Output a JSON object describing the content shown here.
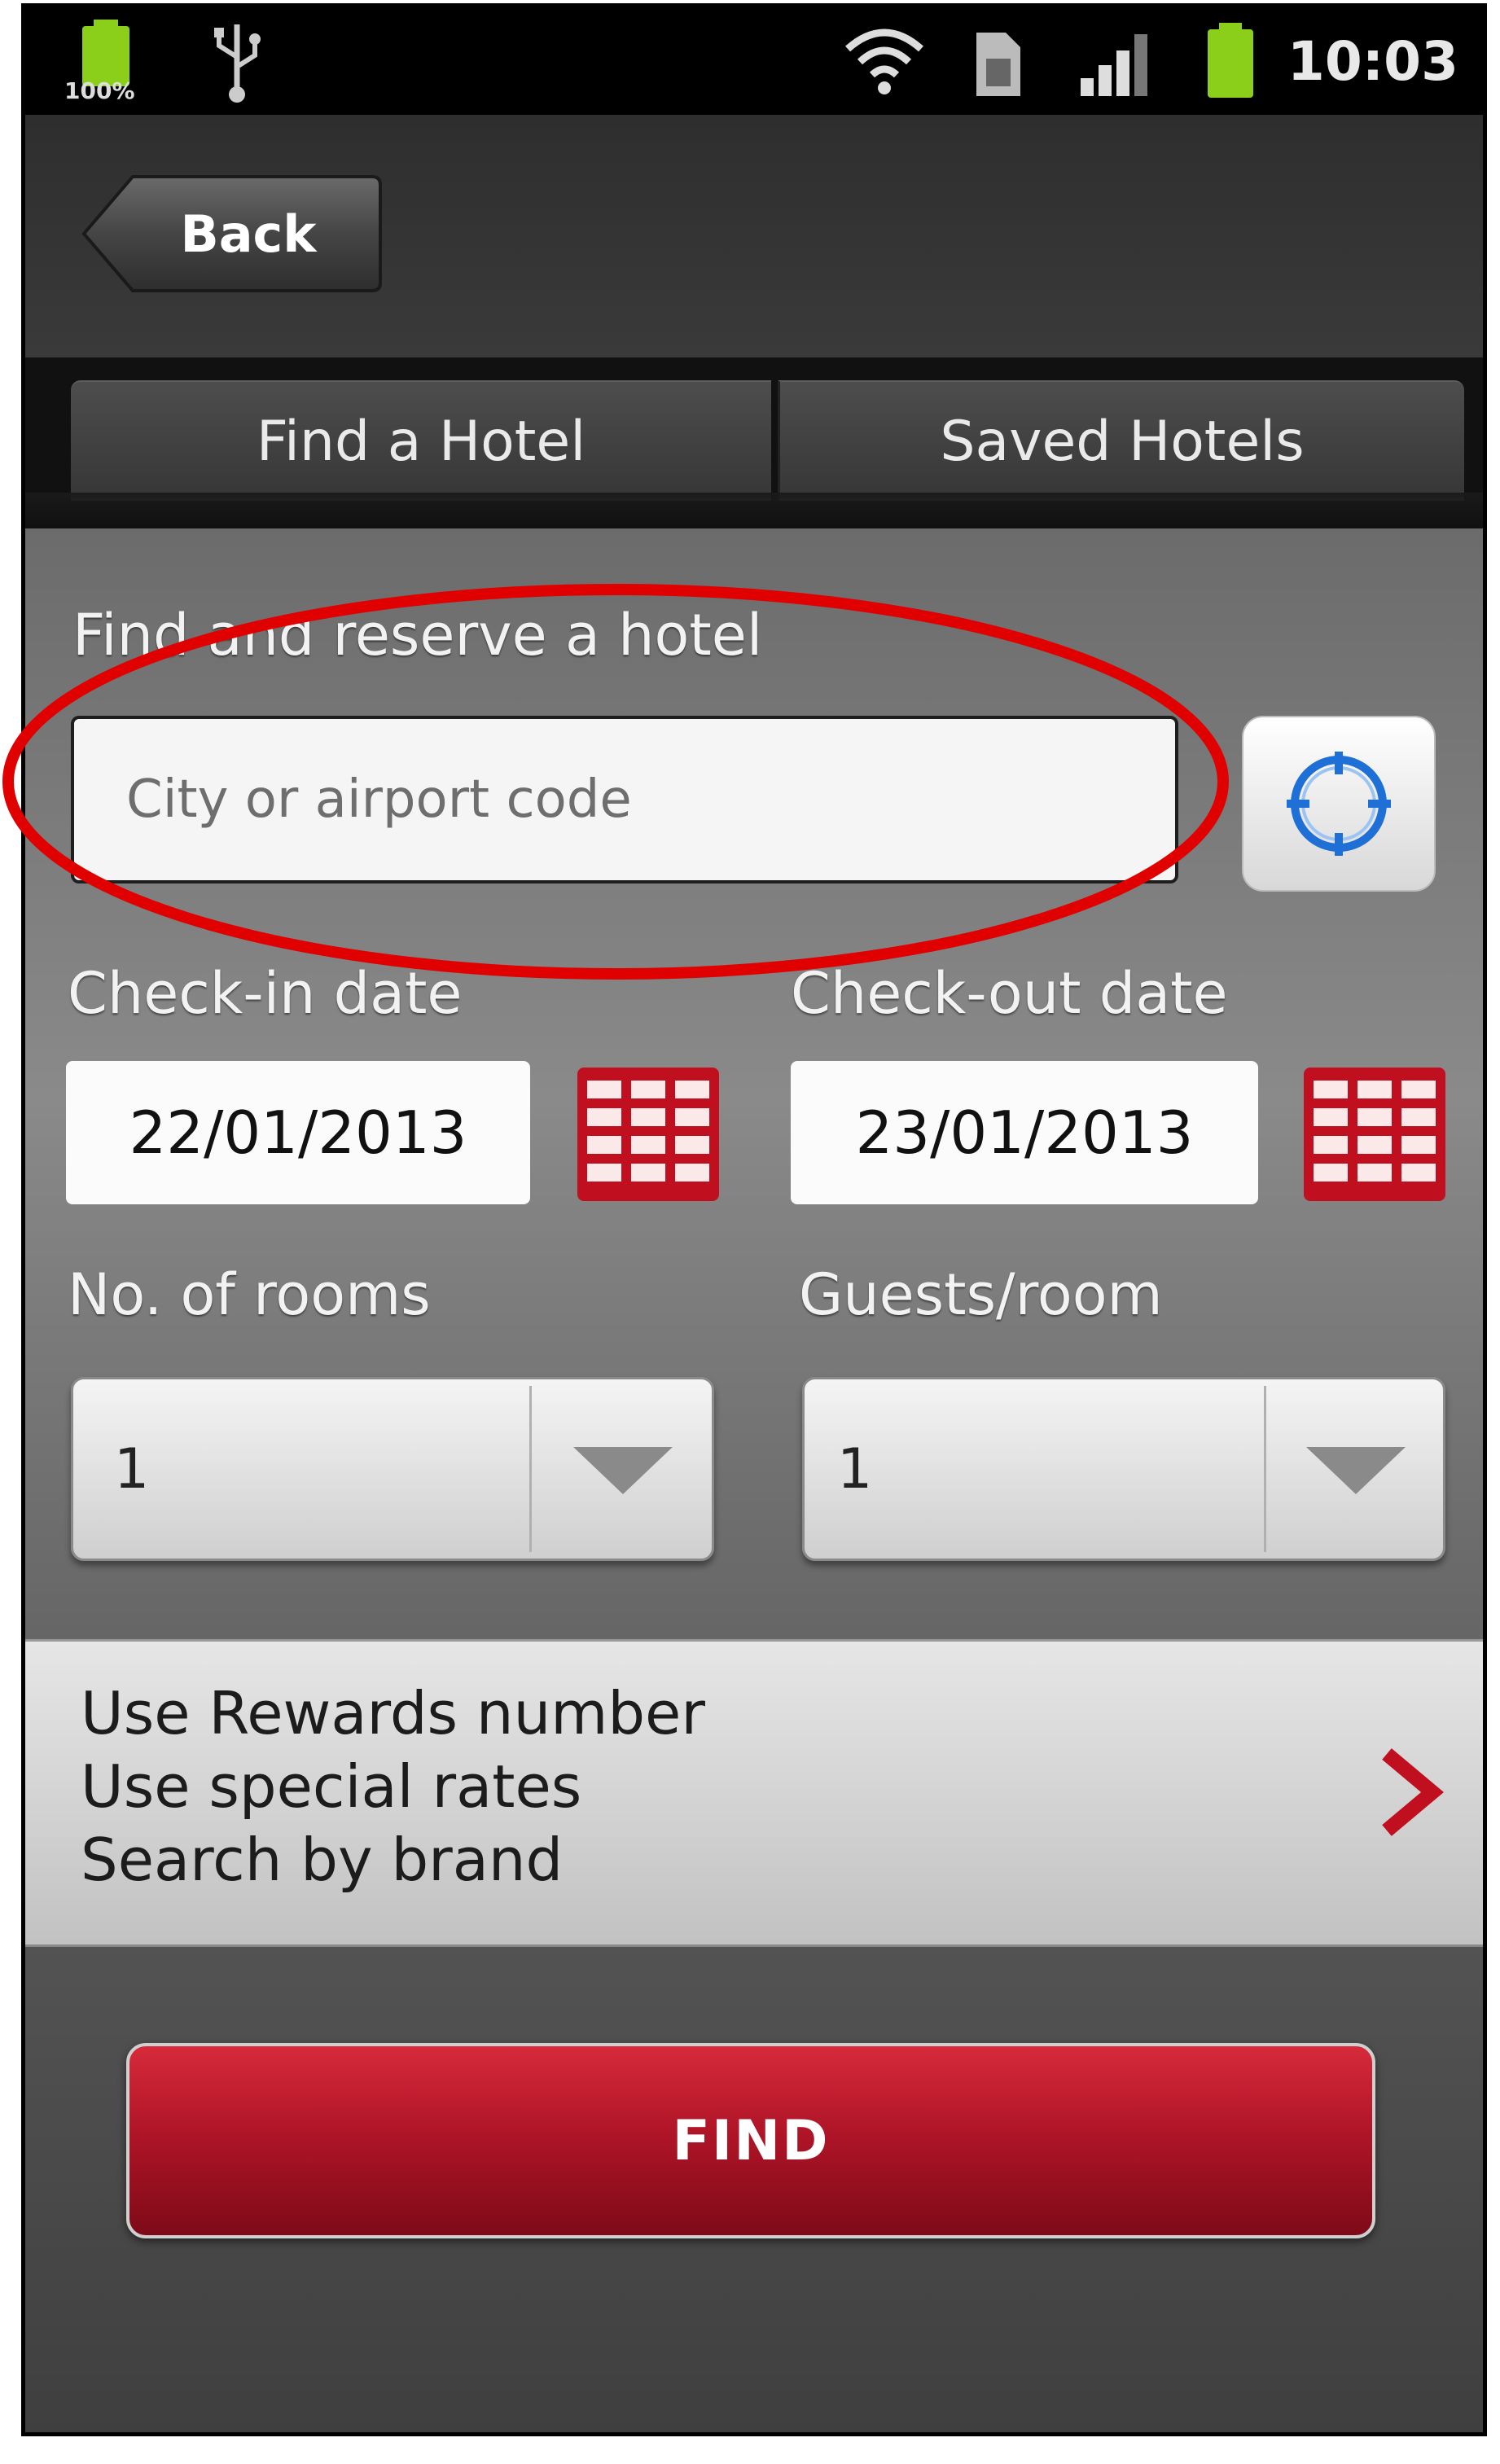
{
  "status_bar": {
    "battery_left_text": "100%",
    "time": "10:03",
    "colors": {
      "battery": "#8ccf1a"
    }
  },
  "header": {
    "back_label": "Back"
  },
  "tabs": [
    {
      "label": "Find a Hotel"
    },
    {
      "label": "Saved Hotels"
    }
  ],
  "search": {
    "heading": "Find and reserve a hotel",
    "city_placeholder": "City or airport code",
    "city_value": "",
    "location_icon": "crosshair-location-icon"
  },
  "dates": {
    "checkin_label": "Check-in date",
    "checkin_value": "22/01/2013",
    "checkout_label": "Check-out date",
    "checkout_value": "23/01/2013",
    "calendar_icon": "calendar-icon"
  },
  "selectors": {
    "rooms_label": "No. of rooms",
    "rooms_value": "1",
    "guests_label": "Guests/room",
    "guests_value": "1"
  },
  "options": {
    "lines": [
      "Use Rewards number",
      "Use special rates",
      "Search by brand"
    ],
    "chevron_icon": "chevron-right-icon"
  },
  "find_button": "FIND",
  "colors": {
    "accent_red": "#b01528",
    "annotation_red": "#e00000",
    "location_blue": "#1e6fd6"
  }
}
